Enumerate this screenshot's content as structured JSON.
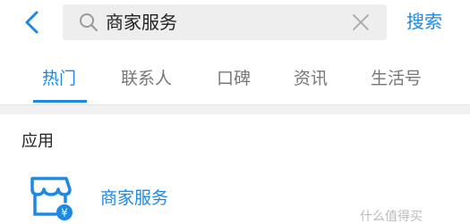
{
  "search": {
    "query": "商家服务",
    "action_label": "搜索"
  },
  "tabs": [
    {
      "label": "热门",
      "active": true
    },
    {
      "label": "联系人",
      "active": false
    },
    {
      "label": "口碑",
      "active": false
    },
    {
      "label": "资讯",
      "active": false
    },
    {
      "label": "生活号",
      "active": false
    }
  ],
  "section": {
    "title": "应用"
  },
  "apps": [
    {
      "name": "商家服务",
      "icon": "merchant-store-icon"
    }
  ],
  "watermark": {
    "text": "什么值得买"
  },
  "colors": {
    "accent": "#1e88e5",
    "tab_inactive": "#777777",
    "search_bg": "#eeeeee"
  }
}
